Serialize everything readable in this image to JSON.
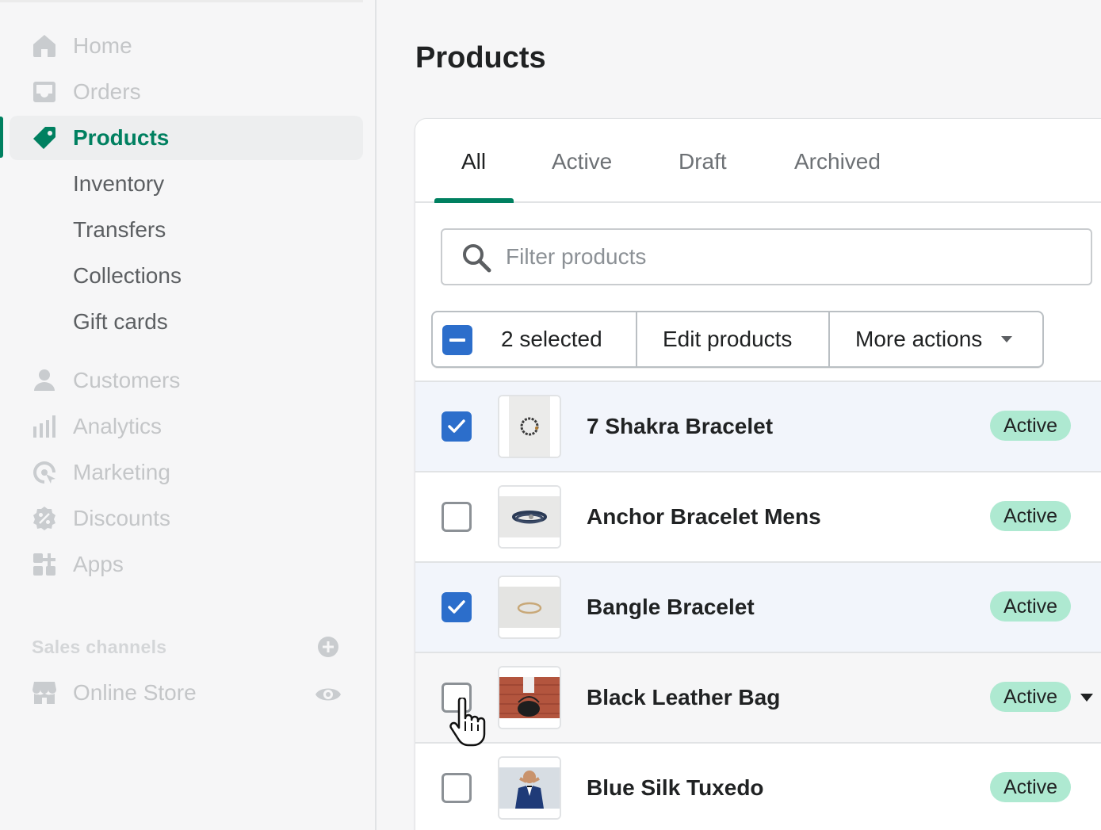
{
  "sidebar": {
    "nav": [
      {
        "label": "Home",
        "icon": "home-icon"
      },
      {
        "label": "Orders",
        "icon": "inbox-icon"
      },
      {
        "label": "Products",
        "icon": "tag-icon"
      }
    ],
    "products_sub": [
      "Inventory",
      "Transfers",
      "Collections",
      "Gift cards"
    ],
    "nav_more": [
      {
        "label": "Customers",
        "icon": "person-icon"
      },
      {
        "label": "Analytics",
        "icon": "bar-chart-icon"
      },
      {
        "label": "Marketing",
        "icon": "target-icon"
      },
      {
        "label": "Discounts",
        "icon": "discount-icon"
      },
      {
        "label": "Apps",
        "icon": "apps-icon"
      }
    ],
    "sales_channels_heading": "Sales channels",
    "online_store": {
      "label": "Online Store",
      "icon": "store-icon"
    }
  },
  "page": {
    "title": "Products"
  },
  "tabs": [
    "All",
    "Active",
    "Draft",
    "Archived"
  ],
  "selected_tab": "All",
  "search": {
    "placeholder": "Filter products"
  },
  "bulk_actions": {
    "selected_label": "2 selected",
    "edit_label": "Edit products",
    "more_label": "More actions"
  },
  "products": [
    {
      "name": "7 Shakra Bracelet",
      "status": "Active",
      "checked": true,
      "thumb": "beaded-bracelet"
    },
    {
      "name": "Anchor Bracelet Mens",
      "status": "Active",
      "checked": false,
      "thumb": "anchor-bracelet"
    },
    {
      "name": "Bangle Bracelet",
      "status": "Active",
      "checked": true,
      "thumb": "bangle"
    },
    {
      "name": "Black Leather Bag",
      "status": "Active",
      "checked": false,
      "thumb": "leather-bag"
    },
    {
      "name": "Blue Silk Tuxedo",
      "status": "Active",
      "checked": false,
      "thumb": "tuxedo"
    }
  ],
  "colors": {
    "brand_green": "#008060",
    "checkbox_blue": "#2c6ecb",
    "badge_green": "#aee9d1",
    "selected_row": "#f2f5fb"
  }
}
